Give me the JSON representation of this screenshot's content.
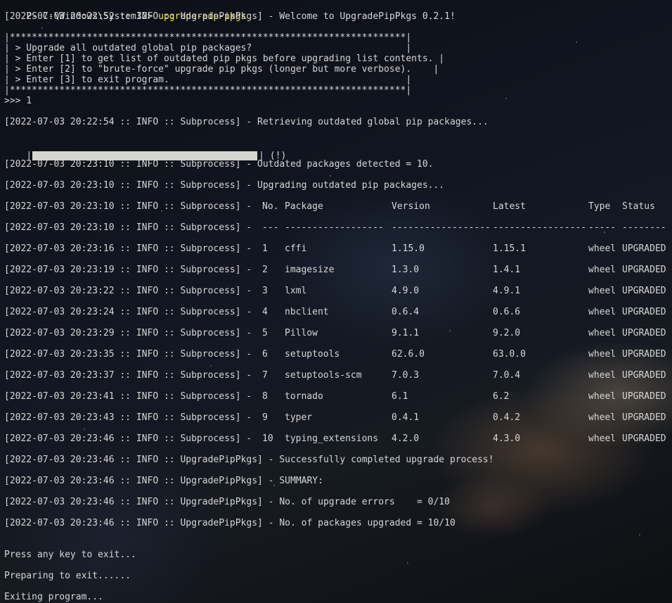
{
  "prompt": {
    "path": "PS C:\\Windows\\System32> ",
    "command": "upgrade-pip-pkgs"
  },
  "welcome_line": "[2022-07-03 20:22:52 :: INFO :: UpgradePipPkgs] - Welcome to UpgradePipPkgs 0.2.1!",
  "menu": {
    "border_top": "|************************************************************************|",
    "lines": [
      "| > Upgrade all outdated global pip packages?                            |",
      "| > Enter [1] to get list of outdated pip pkgs before upgrading list contents. |",
      "| > Enter [2] to \"brute-force\" upgrade pip pkgs (longer but more verbose).    |",
      "| > Enter [3] to exit program.                                           |"
    ],
    "border_bottom": "|************************************************************************|",
    "input_line": ">>> 1"
  },
  "retrieving_line": "[2022-07-03 20:22:54 :: INFO :: Subprocess] - Retrieving outdated global pip packages...",
  "progress": {
    "left_cap": "|",
    "right_cap": "| (!)",
    "fraction": 1.0,
    "fill_color": "#d6d6d0"
  },
  "detected_line": "[2022-07-03 20:23:10 :: INFO :: Subprocess] - Outdated packages detected = 10.",
  "upgrading_line": "[2022-07-03 20:23:10 :: INFO :: Subprocess] - Upgrading outdated pip packages...",
  "table": {
    "header_prefix": "[2022-07-03 20:23:10 :: INFO :: Subprocess] - ",
    "columns": [
      "No.",
      "Package",
      "Version",
      "Latest",
      "Type",
      "Status"
    ],
    "separator_prefix": "[2022-07-03 20:23:10 :: INFO :: Subprocess] - ",
    "separators": [
      "---",
      "------------------",
      "------------------",
      "-----------------",
      "-----",
      "--------"
    ],
    "rows": [
      {
        "prefix": "[2022-07-03 20:23:16 :: INFO :: Subprocess] - ",
        "no": "1",
        "package": "cffi",
        "version": "1.15.0",
        "latest": "1.15.1",
        "type": "wheel",
        "status": "UPGRADED"
      },
      {
        "prefix": "[2022-07-03 20:23:19 :: INFO :: Subprocess] - ",
        "no": "2",
        "package": "imagesize",
        "version": "1.3.0",
        "latest": "1.4.1",
        "type": "wheel",
        "status": "UPGRADED"
      },
      {
        "prefix": "[2022-07-03 20:23:22 :: INFO :: Subprocess] - ",
        "no": "3",
        "package": "lxml",
        "version": "4.9.0",
        "latest": "4.9.1",
        "type": "wheel",
        "status": "UPGRADED"
      },
      {
        "prefix": "[2022-07-03 20:23:24 :: INFO :: Subprocess] - ",
        "no": "4",
        "package": "nbclient",
        "version": "0.6.4",
        "latest": "0.6.6",
        "type": "wheel",
        "status": "UPGRADED"
      },
      {
        "prefix": "[2022-07-03 20:23:29 :: INFO :: Subprocess] - ",
        "no": "5",
        "package": "Pillow",
        "version": "9.1.1",
        "latest": "9.2.0",
        "type": "wheel",
        "status": "UPGRADED"
      },
      {
        "prefix": "[2022-07-03 20:23:35 :: INFO :: Subprocess] - ",
        "no": "6",
        "package": "setuptools",
        "version": "62.6.0",
        "latest": "63.0.0",
        "type": "wheel",
        "status": "UPGRADED"
      },
      {
        "prefix": "[2022-07-03 20:23:37 :: INFO :: Subprocess] - ",
        "no": "7",
        "package": "setuptools-scm",
        "version": "7.0.3",
        "latest": "7.0.4",
        "type": "wheel",
        "status": "UPGRADED"
      },
      {
        "prefix": "[2022-07-03 20:23:41 :: INFO :: Subprocess] - ",
        "no": "8",
        "package": "tornado",
        "version": "6.1",
        "latest": "6.2",
        "type": "wheel",
        "status": "UPGRADED"
      },
      {
        "prefix": "[2022-07-03 20:23:43 :: INFO :: Subprocess] - ",
        "no": "9",
        "package": "typer",
        "version": "0.4.1",
        "latest": "0.4.2",
        "type": "wheel",
        "status": "UPGRADED"
      },
      {
        "prefix": "[2022-07-03 20:23:46 :: INFO :: Subprocess] - ",
        "no": "10",
        "package": "typing_extensions",
        "version": "4.2.0",
        "latest": "4.3.0",
        "type": "wheel",
        "status": "UPGRADED"
      }
    ]
  },
  "completed_line": "[2022-07-03 20:23:46 :: INFO :: UpgradePipPkgs] - Successfully completed upgrade process!",
  "summary_line": "[2022-07-03 20:23:46 :: INFO :: UpgradePipPkgs] - SUMMARY:",
  "errors_line": "[2022-07-03 20:23:46 :: INFO :: UpgradePipPkgs] - No. of upgrade errors    = 0/10",
  "upgraded_line": "[2022-07-03 20:23:46 :: INFO :: UpgradePipPkgs] - No. of packages upgraded = 10/10",
  "press_key_line": "Press any key to exit...",
  "preparing_line": "Preparing to exit......",
  "exiting_line": "Exiting program..."
}
